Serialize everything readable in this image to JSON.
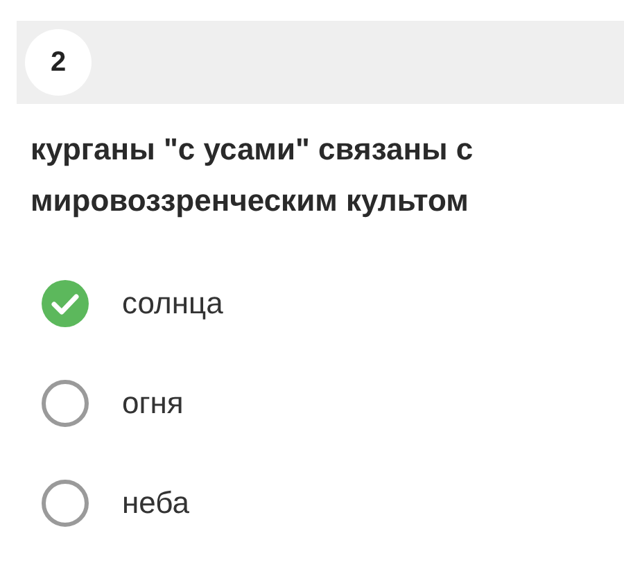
{
  "question": {
    "number": "2",
    "text": "курганы \"с усами\" связаны с мировоззренческим культом"
  },
  "options": [
    {
      "label": "солнца",
      "selected": true
    },
    {
      "label": "огня",
      "selected": false
    },
    {
      "label": "неба",
      "selected": false
    }
  ]
}
